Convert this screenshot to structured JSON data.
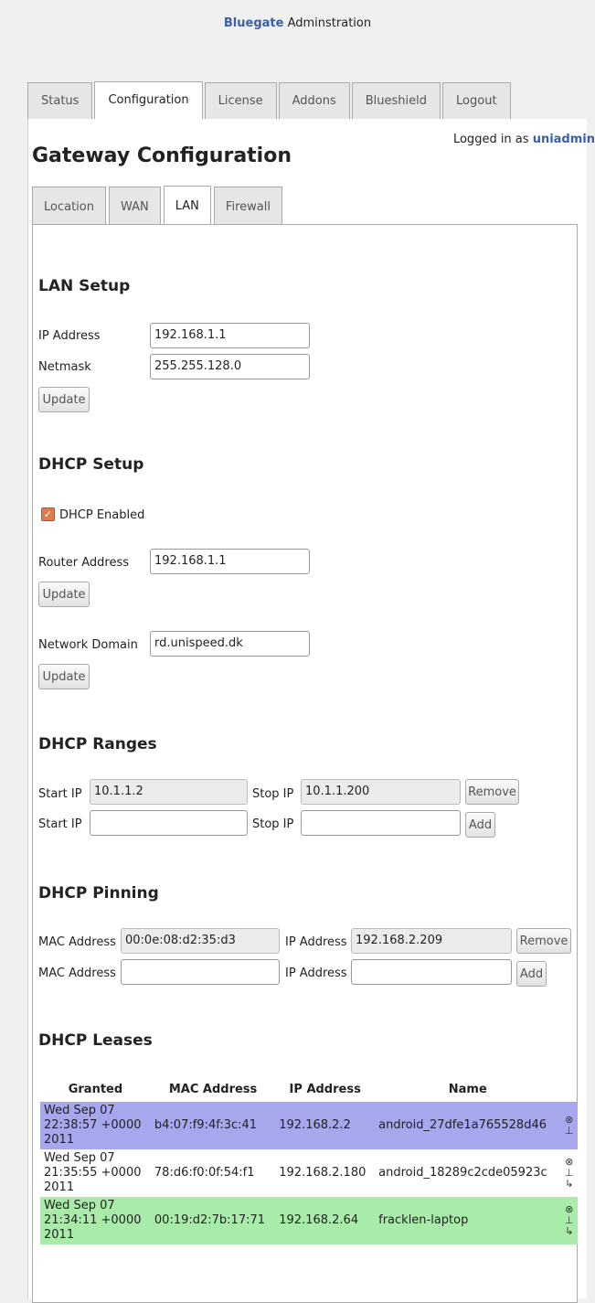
{
  "header": {
    "brand": "Bluegate",
    "title_rest": "Adminstration"
  },
  "main_tabs": [
    {
      "label": "Status"
    },
    {
      "label": "Configuration"
    },
    {
      "label": "License"
    },
    {
      "label": "Addons"
    },
    {
      "label": "Blueshield"
    },
    {
      "label": "Logout"
    }
  ],
  "logged_in": {
    "prefix": "Logged in as",
    "user": "uniadmin"
  },
  "page_title": "Gateway Configuration",
  "sub_tabs": [
    {
      "label": "Location"
    },
    {
      "label": "WAN"
    },
    {
      "label": "LAN"
    },
    {
      "label": "Firewall"
    }
  ],
  "lan_setup": {
    "title": "LAN Setup",
    "ip_label": "IP Address",
    "ip_value": "192.168.1.1",
    "netmask_label": "Netmask",
    "netmask_value": "255.255.128.0",
    "update_label": "Update"
  },
  "dhcp_setup": {
    "title": "DHCP Setup",
    "enabled_label": "DHCP Enabled",
    "router_label": "Router Address",
    "router_value": "192.168.1.1",
    "update_label": "Update",
    "domain_label": "Network Domain",
    "domain_value": "rd.unispeed.dk"
  },
  "dhcp_ranges": {
    "title": "DHCP Ranges",
    "start_label": "Start IP",
    "stop_label": "Stop IP",
    "rows": [
      {
        "start": "10.1.1.2",
        "stop": "10.1.1.200",
        "button": "Remove"
      },
      {
        "start": "",
        "stop": "",
        "button": "Add"
      }
    ]
  },
  "dhcp_pinning": {
    "title": "DHCP Pinning",
    "mac_label": "MAC Address",
    "ip_label": "IP Address",
    "rows": [
      {
        "mac": "00:0e:08:d2:35:d3",
        "ip": "192.168.2.209",
        "button": "Remove"
      },
      {
        "mac": "",
        "ip": "",
        "button": "Add"
      }
    ]
  },
  "dhcp_leases": {
    "title": "DHCP Leases",
    "columns": [
      "Granted",
      "MAC Address",
      "IP Address",
      "Name"
    ],
    "rows": [
      {
        "granted_l1": "Wed Sep 07",
        "granted_l2": "22:38:57 +0000",
        "granted_l3": "2011",
        "mac": "b4:07:f9:4f:3c:41",
        "ip": "192.168.2.2",
        "name": "android_27dfe1a765528d46"
      },
      {
        "granted_l1": "Wed Sep 07",
        "granted_l2": "21:35:55 +0000",
        "granted_l3": "2011",
        "mac": "78:d6:f0:0f:54:f1",
        "ip": "192.168.2.180",
        "name": "android_18289c2cde05923c"
      },
      {
        "granted_l1": "Wed Sep 07",
        "granted_l2": "21:34:11 +0000",
        "granted_l3": "2011",
        "mac": "00:19:d2:7b:17:71",
        "ip": "192.168.2.64",
        "name": "fracklen-laptop"
      }
    ]
  }
}
